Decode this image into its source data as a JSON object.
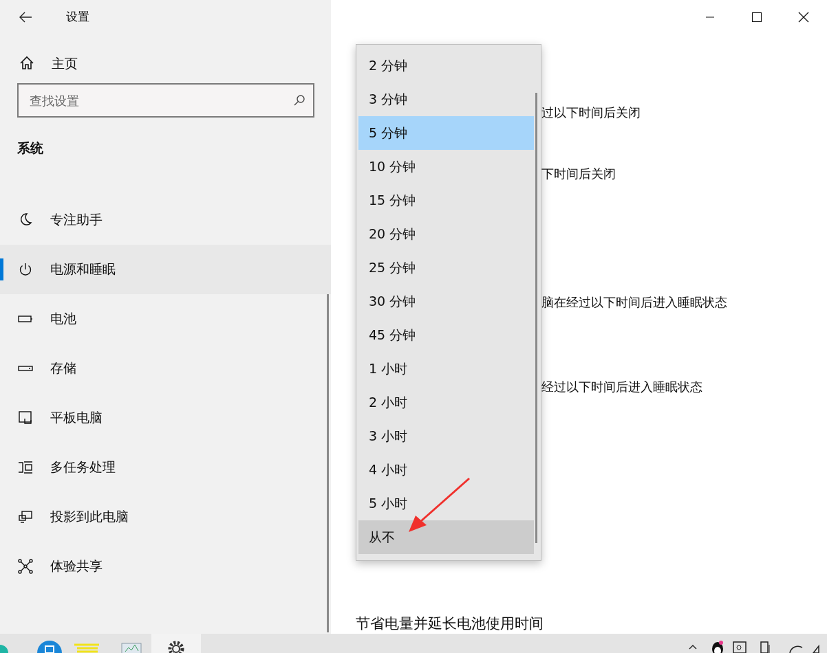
{
  "window": {
    "title": "设置"
  },
  "sidebar": {
    "home": "主页",
    "search": {
      "placeholder": "查找设置"
    },
    "section": "系统",
    "items": [
      {
        "label": "专注助手",
        "selected": false
      },
      {
        "label": "电源和睡眠",
        "selected": true
      },
      {
        "label": "电池",
        "selected": false
      },
      {
        "label": "存储",
        "selected": false
      },
      {
        "label": "平板电脑",
        "selected": false
      },
      {
        "label": "多任务处理",
        "selected": false
      },
      {
        "label": "投影到此电脑",
        "selected": false
      },
      {
        "label": "体验共享",
        "selected": false
      }
    ]
  },
  "content": {
    "lines": [
      "过以下时间后关闭",
      "下时间后关闭",
      "脑在经过以下时间后进入睡眠状态",
      "经过以下时间后进入睡眠状态"
    ],
    "heading": "节省电量并延长电池使用时间"
  },
  "dropdown": {
    "options": [
      {
        "label": "2 分钟",
        "selected": false,
        "hovered": false
      },
      {
        "label": "3 分钟",
        "selected": false,
        "hovered": false
      },
      {
        "label": "5 分钟",
        "selected": true,
        "hovered": false
      },
      {
        "label": "10 分钟",
        "selected": false,
        "hovered": false
      },
      {
        "label": "15 分钟",
        "selected": false,
        "hovered": false
      },
      {
        "label": "20 分钟",
        "selected": false,
        "hovered": false
      },
      {
        "label": "25 分钟",
        "selected": false,
        "hovered": false
      },
      {
        "label": "30 分钟",
        "selected": false,
        "hovered": false
      },
      {
        "label": "45 分钟",
        "selected": false,
        "hovered": false
      },
      {
        "label": "1 小时",
        "selected": false,
        "hovered": false
      },
      {
        "label": "2 小时",
        "selected": false,
        "hovered": false
      },
      {
        "label": "3 小时",
        "selected": false,
        "hovered": false
      },
      {
        "label": "4 小时",
        "selected": false,
        "hovered": false
      },
      {
        "label": "5 小时",
        "selected": false,
        "hovered": false
      },
      {
        "label": "从不",
        "selected": false,
        "hovered": true
      }
    ]
  }
}
